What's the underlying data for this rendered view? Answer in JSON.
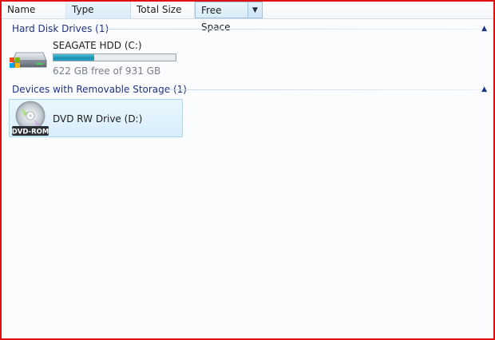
{
  "columns": {
    "name": "Name",
    "type": "Type",
    "total_size": "Total Size",
    "free_space": "Free Space"
  },
  "groups": [
    {
      "title": "Hard Disk Drives (1)",
      "items": [
        {
          "name": "SEAGATE HDD (C:)",
          "space_text": "622 GB free of 931 GB",
          "used_fraction": 0.332,
          "icon": "hard-drive-icon"
        }
      ]
    },
    {
      "title": "Devices with Removable Storage (1)",
      "items": [
        {
          "name": "DVD RW Drive (D:)",
          "icon_label": "DVD-ROM",
          "icon": "dvd-drive-icon"
        }
      ]
    }
  ],
  "colors": {
    "group_title": "#1e3287",
    "usage_bar": "#1d8fb3",
    "selection": "#d7eefb",
    "frame_border": "#e01010"
  }
}
